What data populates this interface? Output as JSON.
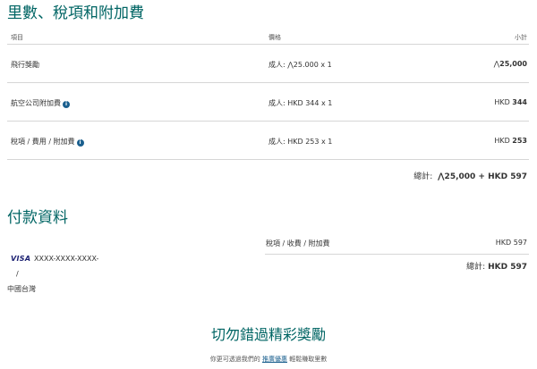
{
  "summary": {
    "title": "里數、稅項和附加費",
    "columns": {
      "item": "項目",
      "price": "價格",
      "subtotal": "小計"
    },
    "rows": [
      {
        "item": "飛行獎勵",
        "price": "成人: ⋀25.000 x 1",
        "subtotal_prefix": "⋀",
        "subtotal_value": "25,000",
        "info": false
      },
      {
        "item": "航空公司附加費",
        "price": "成人: HKD 344 x 1",
        "subtotal_prefix": "HKD ",
        "subtotal_value": "344",
        "info": true
      },
      {
        "item": "稅項 / 費用 / 附加費",
        "price": "成人: HKD 253 x 1",
        "subtotal_prefix": "HKD ",
        "subtotal_value": "253",
        "info": true
      }
    ],
    "total_label": "總計:",
    "total_value": "⋀25,000 + HKD 597"
  },
  "payment": {
    "title": "付款資料",
    "card_brand": "VISA",
    "card_number": "XXXX-XXXX-XXXX-",
    "card_slash": "/",
    "country": "中國台灣",
    "fee_label": "稅項 / 收費 / 附加費",
    "fee_value": "HKD 597",
    "total_label": "總計:",
    "total_value": "HKD 597"
  },
  "promo": {
    "title": "切勿錯過精彩獎勵",
    "text_before": "你更可透過我們的",
    "link": "推廣優惠",
    "text_after": "輕鬆賺取里數"
  },
  "colors": {
    "heading": "#006564",
    "link": "#1a5f8e",
    "divider": "#d6d6d6"
  }
}
